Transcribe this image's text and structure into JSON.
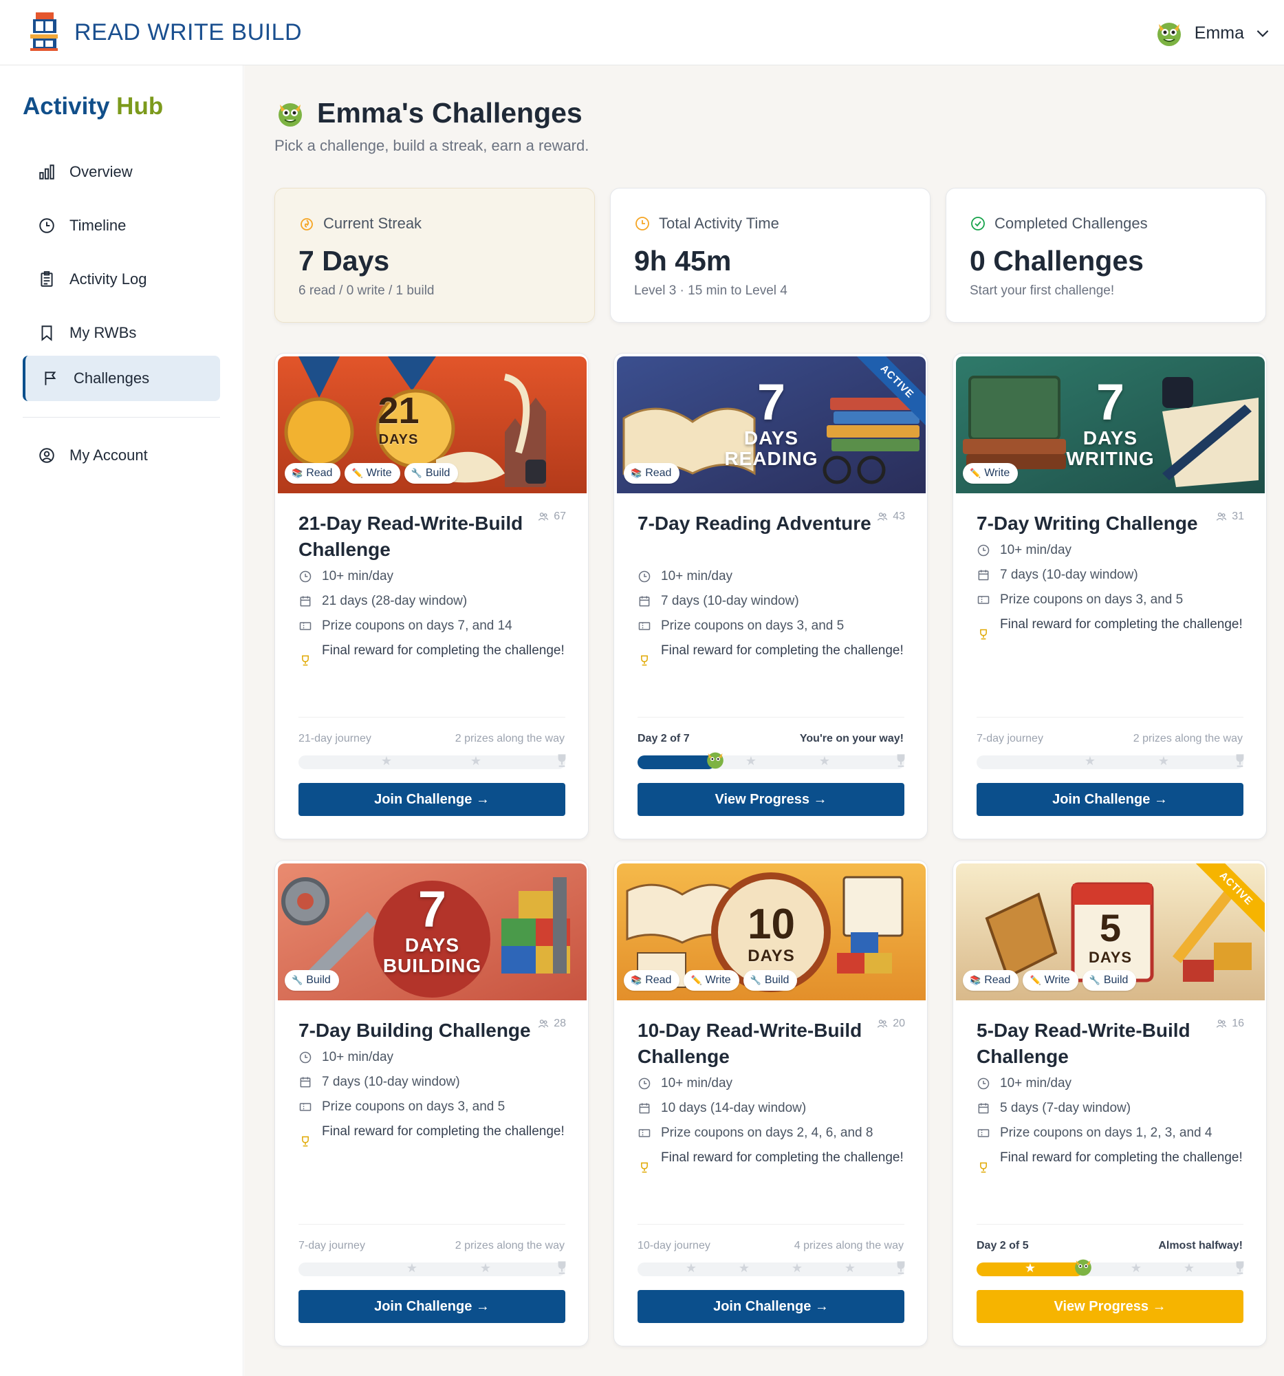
{
  "app": {
    "logo_text": "READ WRITE BUILD"
  },
  "user": {
    "name": "Emma",
    "avatar_icon": "dragon-avatar-icon"
  },
  "sidebar": {
    "title_part1": "Activity",
    "title_part2": "Hub",
    "items": [
      {
        "label": "Overview",
        "icon": "bar-chart-icon"
      },
      {
        "label": "Timeline",
        "icon": "clock-icon"
      },
      {
        "label": "Activity Log",
        "icon": "clipboard-icon"
      },
      {
        "label": "My RWBs",
        "icon": "bookmark-icon"
      },
      {
        "label": "Challenges",
        "icon": "flag-icon",
        "active": true
      },
      {
        "label": "My Account",
        "icon": "user-circle-icon"
      }
    ]
  },
  "page": {
    "title": "Emma's Challenges",
    "subtitle": "Pick a challenge, build a streak, earn a reward."
  },
  "stats": [
    {
      "label": "Current Streak",
      "value": "7 Days",
      "sub": "6 read / 0 write / 1 build",
      "icon": "flame-icon",
      "color": "#f5a524"
    },
    {
      "label": "Total Activity Time",
      "value": "9h 45m",
      "sub": "Level 3 · 15 min to Level 4",
      "icon": "clock-icon",
      "color": "#f5a524"
    },
    {
      "label": "Completed Challenges",
      "value": "0 Challenges",
      "sub": "Start your first challenge!",
      "icon": "check-circle-icon",
      "color": "#16a34a"
    }
  ],
  "cards": [
    {
      "image_number": "21",
      "image_word": "DAYS",
      "tags": [
        "Read",
        "Write",
        "Build"
      ],
      "title": "21-Day Read-Write-Build Challenge",
      "count": "67",
      "details": [
        "10+ min/day",
        "21 days (28-day window)",
        "Prize coupons on days 7, and 14"
      ],
      "reward": "Final reward for completing the challenge!",
      "journey_left": "21-day journey",
      "journey_right": "2 prizes along the way",
      "button": "Join Challenge →"
    },
    {
      "image_number": "7",
      "image_word": "DAYS",
      "image_word2": "READING",
      "ribbon": "ACTIVE",
      "tags": [
        "Read"
      ],
      "title": "7-Day Reading Adventure",
      "count": "43",
      "details": [
        "10+ min/day",
        "7 days (10-day window)",
        "Prize coupons on days 3, and 5"
      ],
      "reward": "Final reward for completing the challenge!",
      "journey_left": "Day 2 of 7",
      "journey_right": "You're on your way!",
      "progress": 0.29,
      "button": "View Progress →"
    },
    {
      "image_number": "7",
      "image_word": "DAYS",
      "image_word2": "WRITING",
      "tags": [
        "Write"
      ],
      "title": "7-Day Writing Challenge",
      "count": "31",
      "details": [
        "10+ min/day",
        "7 days (10-day window)",
        "Prize coupons on days 3, and 5"
      ],
      "reward": "Final reward for completing the challenge!",
      "journey_left": "7-day journey",
      "journey_right": "2 prizes along the way",
      "button": "Join Challenge →"
    },
    {
      "image_number": "7",
      "image_word": "DAYS",
      "image_word2": "BUILDING",
      "tags": [
        "Build"
      ],
      "title": "7-Day Building Challenge",
      "count": "28",
      "details": [
        "10+ min/day",
        "7 days (10-day window)",
        "Prize coupons on days 3, and 5"
      ],
      "reward": "Final reward for completing the challenge!",
      "journey_left": "7-day journey",
      "journey_right": "2 prizes along the way",
      "button": "Join Challenge →"
    },
    {
      "image_number": "10",
      "image_word": "DAYS",
      "tags": [
        "Read",
        "Write",
        "Build"
      ],
      "title": "10-Day Read-Write-Build Challenge",
      "count": "20",
      "details": [
        "10+ min/day",
        "10 days (14-day window)",
        "Prize coupons on days 2, 4, 6, and 8"
      ],
      "reward": "Final reward for completing the challenge!",
      "journey_left": "10-day journey",
      "journey_right": "4 prizes along the way",
      "button": "Join Challenge →"
    },
    {
      "image_number": "5",
      "image_word": "DAYS",
      "ribbon": "ACTIVE",
      "tags": [
        "Read",
        "Write",
        "Build"
      ],
      "title": "5-Day Read-Write-Build Challenge",
      "count": "16",
      "details": [
        "10+ min/day",
        "5 days (7-day window)",
        "Prize coupons on days 1, 2, 3, and 4"
      ],
      "reward": "Final reward for completing the challenge!",
      "journey_left": "Day 2 of 5",
      "journey_right": "Almost halfway!",
      "progress": 0.4,
      "button": "View Progress →"
    }
  ],
  "colors": {
    "brand_blue": "#0b4f8c",
    "gold": "#f6b400",
    "hub_green": "#7c9a1c"
  }
}
